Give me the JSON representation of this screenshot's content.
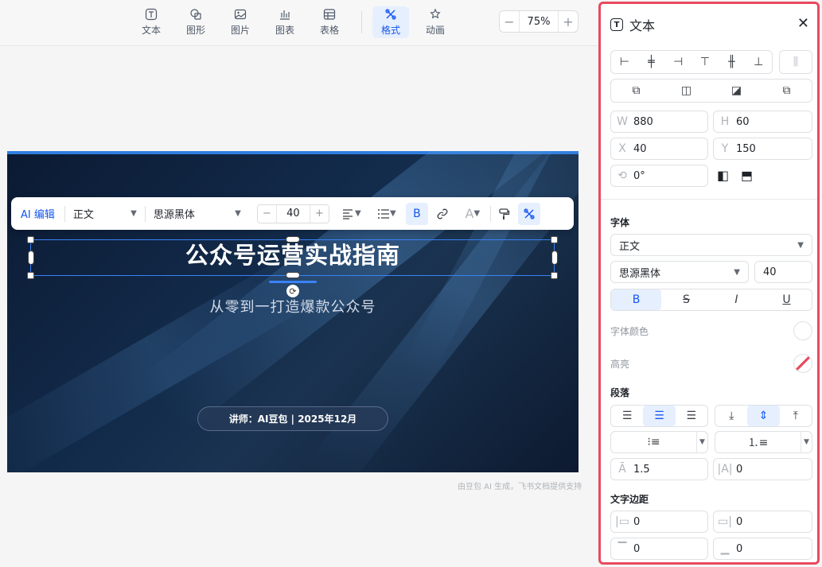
{
  "toolbar": {
    "items": [
      {
        "label": "文本",
        "icon": "text-icon"
      },
      {
        "label": "图形",
        "icon": "shape-icon"
      },
      {
        "label": "图片",
        "icon": "image-icon"
      },
      {
        "label": "图表",
        "icon": "chart-icon"
      },
      {
        "label": "表格",
        "icon": "table-icon"
      },
      {
        "label": "格式",
        "icon": "format-icon"
      },
      {
        "label": "动画",
        "icon": "animation-icon"
      }
    ],
    "zoom": "75%",
    "zoom_minus": "−",
    "zoom_plus": "+"
  },
  "slide": {
    "title": "公众号运营实战指南",
    "subtitle": "从零到一打造爆款公众号",
    "badge": "讲师：AI豆包 | 2025年12月"
  },
  "float_toolbar": {
    "ai_edit": "AI 编辑",
    "style": "正文",
    "font": "思源黑体",
    "size": "40",
    "minus": "−",
    "plus": "+",
    "bold": "B"
  },
  "footer_note": "由豆包 AI 生成，飞书文档提供支持",
  "panel": {
    "title": "文本",
    "close": "✕",
    "w_label": "W",
    "w_value": "880",
    "h_label": "H",
    "h_value": "60",
    "x_label": "X",
    "x_value": "40",
    "y_label": "Y",
    "y_value": "150",
    "rotation": "0°",
    "font_section": "字体",
    "style_value": "正文",
    "font_value": "思源黑体",
    "size_value": "40",
    "bold": "B",
    "strike": "S",
    "italic": "I",
    "underline": "U",
    "font_color_label": "字体颜色",
    "highlight_label": "高亮",
    "paragraph_section": "段落",
    "line_height": "1.5",
    "letter_spacing": "0",
    "padding_section": "文字边距",
    "pad_left": "0",
    "pad_right": "0",
    "pad_top": "0",
    "pad_bottom": "0"
  },
  "colors": {
    "accent": "#1456f0",
    "panel_border": "#e84a5f",
    "slide_bg": "#0b1a33"
  }
}
